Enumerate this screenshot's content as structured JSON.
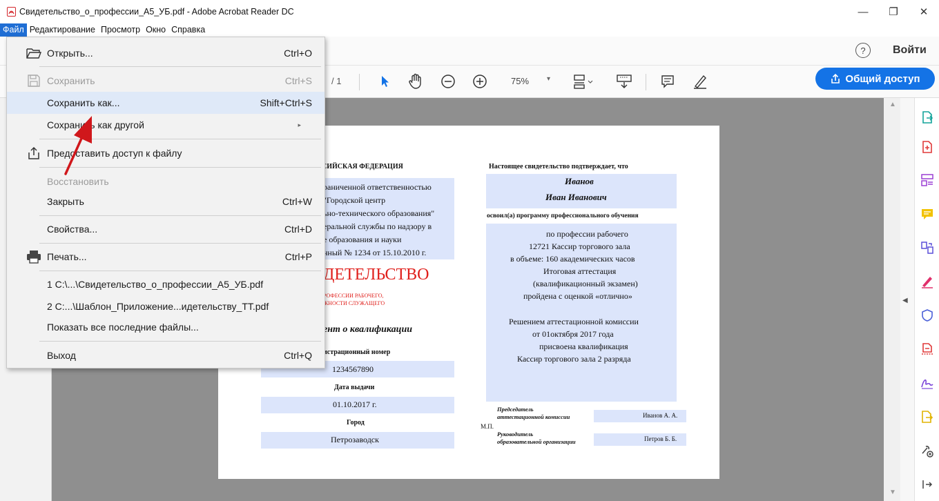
{
  "window": {
    "title": "Свидетельство_о_профессии_А5_УБ.pdf - Adobe Acrobat Reader DC",
    "minimize": "—",
    "restore": "❐",
    "close": "✕"
  },
  "menubar": {
    "items": [
      "Файл",
      "Редактирование",
      "Просмотр",
      "Окно",
      "Справка"
    ]
  },
  "toolbar": {
    "help": "?",
    "sign_in": "Войти",
    "page_count": "/ 1",
    "zoom": "75%",
    "zoom_arrow": "▾",
    "share_label": "Общий доступ"
  },
  "file_menu": {
    "items": [
      {
        "label": "Открыть...",
        "shortcut": "Ctrl+O",
        "icon": "open-folder-icon"
      },
      {
        "label": "Сохранить",
        "shortcut": "Ctrl+S",
        "icon": "save-icon",
        "disabled": true
      },
      {
        "label": "Сохранить как...",
        "shortcut": "Shift+Ctrl+S",
        "hover": true
      },
      {
        "label": "Сохранить как другой",
        "submenu": "▸"
      },
      {
        "label": "Предоставить доступ к файлу",
        "icon": "share-icon"
      },
      {
        "label": "Восстановить",
        "disabled": true
      },
      {
        "label": "Закрыть",
        "shortcut": "Ctrl+W"
      },
      {
        "label": "Свойства...",
        "shortcut": "Ctrl+D"
      },
      {
        "label": "Печать...",
        "shortcut": "Ctrl+P",
        "icon": "printer-icon"
      },
      {
        "label": "1 C:\\...\\Свидетельство_о_профессии_А5_УБ.pdf"
      },
      {
        "label": "2 C:...\\Шаблон_Приложение...идетельству_ТТ.pdf"
      },
      {
        "label": "Показать все последние файлы..."
      },
      {
        "label": "Выход",
        "shortcut": "Ctrl+Q"
      }
    ]
  },
  "document": {
    "left": {
      "country": "СИЙСКАЯ ФЕДЕРАЦИЯ",
      "org_lines": [
        "раниченной ответственностью",
        "\"Городской центр",
        "ьно-технического образования\"",
        "еральной службы по надзору в",
        "е образования и науки",
        "нный № 1234 от 15.10.2010 г."
      ],
      "title": "ДЕТЕЛЬСТВО",
      "subtitle_lines": [
        "РОФЕССИИ РАБОЧЕГО,",
        "ЖНОСТИ СЛУЖАЩЕГО"
      ],
      "doc_type": "ент о квалификации",
      "reg_label": "истрационный номер",
      "reg_number": "1234567890",
      "issue_label": "Дата выдачи",
      "issue_date": "01.10.2017 г.",
      "city_label": "Город",
      "city": "Петрозаводск"
    },
    "right": {
      "confirms": "Настоящее свидетельство подтверждает, что",
      "surname": "Иванов",
      "name": "Иван Иванович",
      "mastered": "освоил(а) программу профессионального обучения",
      "program_lines": [
        "по профессии рабочего",
        "12721  Кассир торгового зала",
        "в объеме: 160 академических часов",
        "Итоговая аттестация",
        "(квалификационный экзамен)",
        "пройдена с оценкой «отлично»",
        "",
        "Решением аттестационной комиссии",
        "от 01октября 2017 года",
        "присвоена квалификация",
        "Кассир торгового зала 2 разряда"
      ],
      "chair_label_1": "Председатель",
      "chair_label_2": "аттестационной комиссии",
      "chair_name": "Иванов А. А.",
      "mp": "М.П.",
      "head_label_1": "Руководитель",
      "head_label_2": "образовательной организации",
      "head_name": "Петров Б. Б."
    }
  },
  "colors": {
    "accent": "#1473e6",
    "menu_hover": "#dfe9f8",
    "field_fill": "#dce5fb",
    "title_red": "#e0201c",
    "arrow_red": "#d0171b"
  }
}
